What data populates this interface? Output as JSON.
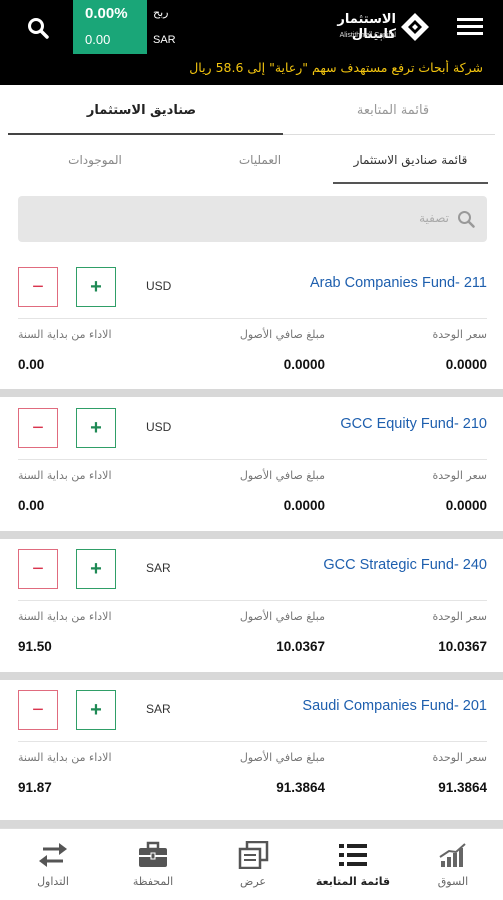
{
  "header": {
    "profit_percent": "0.00%",
    "profit_value": "0.00",
    "profit_label": "ربح",
    "currency": "SAR",
    "logo_ar": "الاستثمار كابيتال",
    "logo_en": "Alistithmar Capital",
    "ticker": "شركة أبحاث ترفع مستهدف سهم \"رعاية\" إلى 58.6 ريال"
  },
  "main_tabs": [
    {
      "label": "صناديق الاستثمار",
      "active": true
    },
    {
      "label": "قائمة المتابعة",
      "active": false
    }
  ],
  "sub_tabs": [
    {
      "label": "الموجودات"
    },
    {
      "label": "العمليات"
    },
    {
      "label": "قائمة صناديق الاستثمار",
      "active": true
    }
  ],
  "search": {
    "placeholder": "تصفية"
  },
  "field_labels": {
    "unit_price": "سعر الوحدة",
    "net_assets": "مبلغ صافي الأصول",
    "ytd": "الاداء من بداية السنة"
  },
  "funds": [
    {
      "name": "Arab Companies Fund- 211",
      "currency": "USD",
      "unit_price": "0.0000",
      "net_assets": "0.0000",
      "ytd": "0.00"
    },
    {
      "name": "GCC Equity Fund- 210",
      "currency": "USD",
      "unit_price": "0.0000",
      "net_assets": "0.0000",
      "ytd": "0.00"
    },
    {
      "name": "GCC Strategic Fund- 240",
      "currency": "SAR",
      "unit_price": "10.0367",
      "net_assets": "10.0367",
      "ytd": "91.50"
    },
    {
      "name": "Saudi Companies Fund- 201",
      "currency": "SAR",
      "unit_price": "91.3864",
      "net_assets": "91.3864",
      "ytd": "91.87"
    }
  ],
  "buttons": {
    "minus": "−",
    "plus": "+"
  },
  "bottom_nav": [
    {
      "label": "التداول",
      "icon": "transfer-arrows-icon"
    },
    {
      "label": "المحفظة",
      "icon": "briefcase-icon"
    },
    {
      "label": "عرض",
      "icon": "stacked-windows-icon"
    },
    {
      "label": "قائمة المتابعة",
      "icon": "list-icon",
      "active": true
    },
    {
      "label": "السوق",
      "icon": "bar-chart-icon"
    }
  ],
  "colors": {
    "header_bg": "#000000",
    "profit_bg": "#1aa678",
    "ticker": "#f2c40f",
    "fund_name": "#1e5fae",
    "minus": "#d9344e",
    "plus": "#1f8a55"
  }
}
